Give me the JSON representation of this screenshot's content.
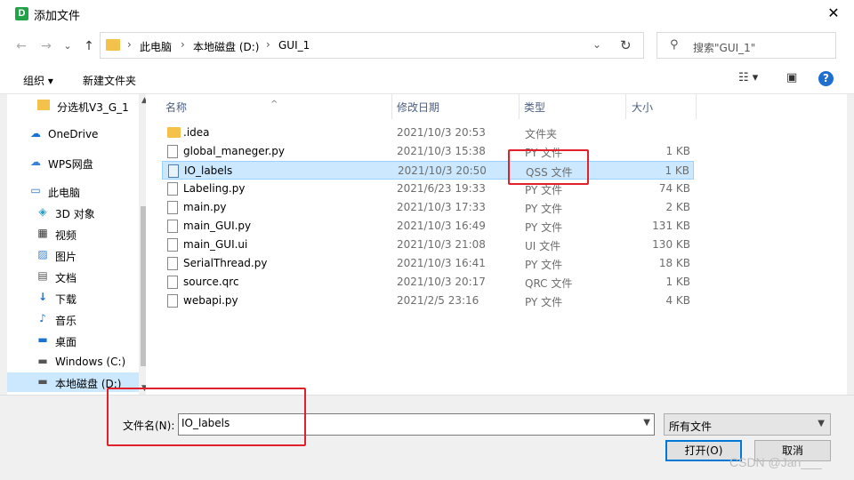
{
  "window": {
    "app_icon": "D",
    "title": "添加文件",
    "close": "✕"
  },
  "nav": {
    "back": "←",
    "forward": "→",
    "recent": "⌄",
    "up": "↑",
    "breadcrumb": [
      "此电脑",
      "本地磁盘 (D:)",
      "GUI_1"
    ],
    "sep": "›",
    "search_placeholder": "搜索\"GUI_1\""
  },
  "toolbar": {
    "organize": "组织 ▾",
    "new_folder": "新建文件夹",
    "help": "?"
  },
  "sidebar": {
    "items": [
      {
        "label": "分选机V3_G_1",
        "icon": "folder-icon"
      },
      {
        "label": "OneDrive",
        "icon": "cloud-icon"
      },
      {
        "label": "WPS网盘",
        "icon": "cloud-icon"
      },
      {
        "label": "此电脑",
        "icon": "computer-icon"
      },
      {
        "label": "3D 对象",
        "icon": "cube-icon"
      },
      {
        "label": "视频",
        "icon": "video-icon"
      },
      {
        "label": "图片",
        "icon": "picture-icon"
      },
      {
        "label": "文档",
        "icon": "document-icon"
      },
      {
        "label": "下载",
        "icon": "download-icon"
      },
      {
        "label": "音乐",
        "icon": "music-icon"
      },
      {
        "label": "桌面",
        "icon": "desktop-icon"
      },
      {
        "label": "Windows (C:)",
        "icon": "drive-icon"
      },
      {
        "label": "本地磁盘 (D:)",
        "icon": "drive-icon"
      }
    ]
  },
  "columns": {
    "name": "名称",
    "date": "修改日期",
    "type": "类型",
    "size": "大小"
  },
  "files": [
    {
      "name": ".idea",
      "date": "2021/10/3 20:53",
      "type": "文件夹",
      "size": "",
      "kind": "folder"
    },
    {
      "name": "global_maneger.py",
      "date": "2021/10/3 15:38",
      "type": "PY 文件",
      "size": "1 KB",
      "kind": "file"
    },
    {
      "name": "IO_labels",
      "date": "2021/10/3 20:50",
      "type": "QSS 文件",
      "size": "1 KB",
      "kind": "qss"
    },
    {
      "name": "Labeling.py",
      "date": "2021/6/23 19:33",
      "type": "PY 文件",
      "size": "74 KB",
      "kind": "file"
    },
    {
      "name": "main.py",
      "date": "2021/10/3 17:33",
      "type": "PY 文件",
      "size": "2 KB",
      "kind": "file"
    },
    {
      "name": "main_GUI.py",
      "date": "2021/10/3 16:49",
      "type": "PY 文件",
      "size": "131 KB",
      "kind": "file"
    },
    {
      "name": "main_GUI.ui",
      "date": "2021/10/3 21:08",
      "type": "UI 文件",
      "size": "130 KB",
      "kind": "file"
    },
    {
      "name": "SerialThread.py",
      "date": "2021/10/3 16:41",
      "type": "PY 文件",
      "size": "18 KB",
      "kind": "file"
    },
    {
      "name": "source.qrc",
      "date": "2021/10/3 20:17",
      "type": "QRC 文件",
      "size": "1 KB",
      "kind": "file"
    },
    {
      "name": "webapi.py",
      "date": "2021/2/5 23:16",
      "type": "PY 文件",
      "size": "4 KB",
      "kind": "file"
    }
  ],
  "footer": {
    "filename_label": "文件名(N):",
    "filename_value": "IO_labels",
    "filetype_value": "所有文件",
    "open_button": "打开(O)",
    "cancel_button": "取消"
  },
  "watermark": "CSDN @Jan___",
  "colors": {
    "selection": "#cce8ff",
    "annotation": "#e0202a",
    "accent": "#0078d7"
  }
}
